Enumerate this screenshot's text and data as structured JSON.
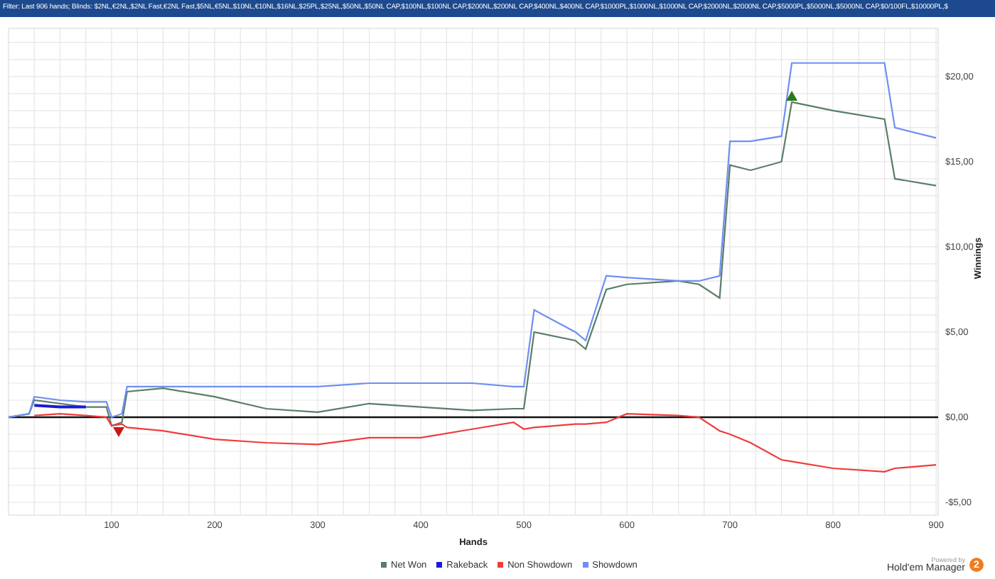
{
  "filter_bar": {
    "text": "Filter: Last 906 hands; Blinds: $2NL,€2NL,$2NL Fast,€2NL Fast,$5NL,€5NL,$10NL,€10NL,$16NL,$25PL,$25NL,$50NL,$50NL CAP,$100NL,$100NL CAP,$200NL,$200NL CAP,$400NL,$400NL CAP,$1000PL,$1000NL,$1000NL CAP,$2000NL,$2000NL CAP,$5000PL,$5000NL,$5000NL CAP,$0/100FL,$10000PL,$"
  },
  "chart": {
    "chart_data": {
      "type": "line",
      "xlabel": "Hands",
      "ylabel": "Winnings",
      "x": [
        0,
        20,
        25,
        50,
        75,
        95,
        100,
        110,
        115,
        150,
        200,
        250,
        300,
        350,
        400,
        450,
        490,
        500,
        510,
        550,
        560,
        580,
        600,
        650,
        670,
        690,
        700,
        720,
        750,
        760,
        800,
        850,
        860,
        900
      ],
      "series": [
        {
          "name": "Net Won",
          "color": "#5b7d66",
          "values": [
            0,
            0.2,
            1.0,
            0.8,
            0.6,
            0.6,
            -0.5,
            -0.3,
            1.5,
            1.7,
            1.2,
            0.5,
            0.3,
            0.8,
            0.6,
            0.4,
            0.5,
            0.5,
            5.0,
            4.5,
            4.0,
            7.5,
            7.8,
            8.0,
            7.8,
            7.0,
            14.8,
            14.5,
            15.0,
            18.5,
            18.0,
            17.5,
            14.0,
            13.6
          ]
        },
        {
          "name": "Rakeback",
          "color": "#1a1ad8",
          "values": [
            null,
            null,
            0.7,
            0.6,
            0.6,
            null,
            null,
            null,
            null,
            null,
            null,
            null,
            null,
            null,
            null,
            null,
            null,
            null,
            null,
            null,
            null,
            null,
            null,
            null,
            null,
            null,
            null,
            null,
            null,
            null,
            null,
            null,
            null,
            null
          ]
        },
        {
          "name": "Non Showdown",
          "color": "#f03c3c",
          "values": [
            null,
            null,
            0.1,
            0.2,
            0.1,
            0,
            -0.5,
            -0.4,
            -0.6,
            -0.8,
            -1.3,
            -1.5,
            -1.6,
            -1.2,
            -1.2,
            -0.7,
            -0.3,
            -0.7,
            -0.6,
            -0.4,
            -0.4,
            -0.3,
            0.2,
            0.1,
            0,
            -0.8,
            -1.0,
            -1.5,
            -2.5,
            -2.6,
            -3.0,
            -3.2,
            -3.0,
            -2.8
          ]
        },
        {
          "name": "Showdown",
          "color": "#6e8ff2",
          "values": [
            0,
            0.2,
            1.2,
            1.0,
            0.9,
            0.9,
            0,
            0.2,
            1.8,
            1.8,
            1.8,
            1.8,
            1.8,
            2.0,
            2.0,
            2.0,
            1.8,
            1.8,
            6.3,
            5.0,
            4.5,
            8.3,
            8.2,
            8.0,
            8.0,
            8.3,
            16.2,
            16.2,
            16.5,
            20.8,
            20.8,
            20.8,
            17.0,
            16.4
          ]
        }
      ],
      "grid": true,
      "xlim": [
        0,
        902
      ],
      "ylim": [
        -5.75,
        22.83
      ],
      "xticks": [
        100,
        200,
        300,
        400,
        500,
        600,
        700,
        800,
        900
      ],
      "yticks": [
        {
          "value": -5,
          "label": "-$5,00"
        },
        {
          "value": 0,
          "label": "$0,00"
        },
        {
          "value": 5,
          "label": "$5,00"
        },
        {
          "value": 10,
          "label": "$10,00"
        },
        {
          "value": 15,
          "label": "$15,00"
        },
        {
          "value": 20,
          "label": "$20,00"
        }
      ]
    }
  },
  "branding": {
    "caption": "Powered by",
    "name": "Hold'em Manager",
    "badge": "2"
  }
}
